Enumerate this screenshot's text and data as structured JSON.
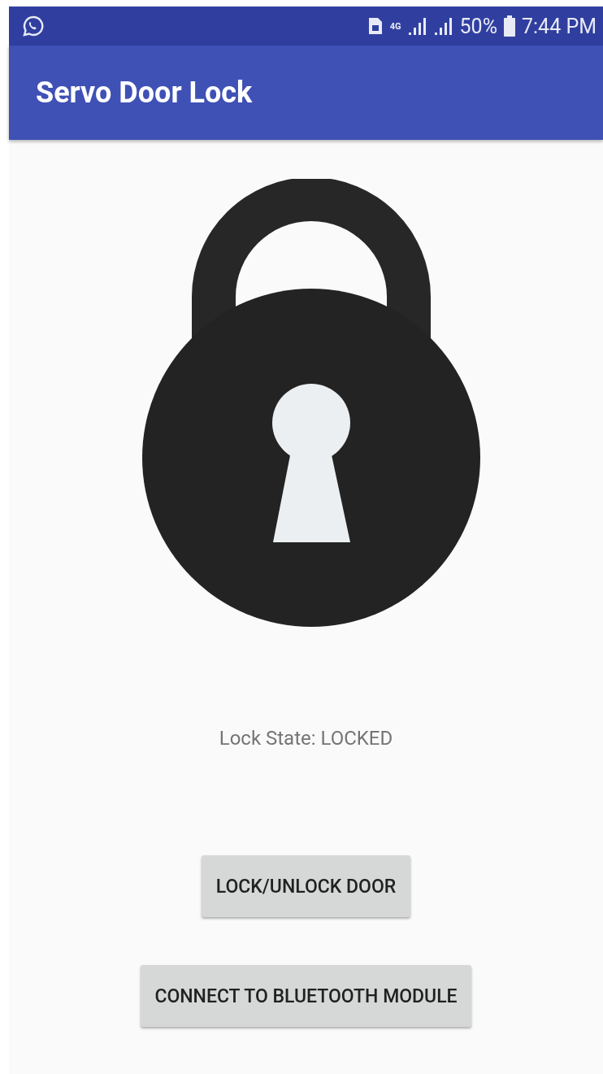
{
  "status_bar": {
    "network": "4G",
    "battery": "50%",
    "time": "7:44 PM"
  },
  "app_bar": {
    "title": "Servo Door Lock"
  },
  "lock_state": "Lock State: LOCKED",
  "buttons": [
    {
      "label": "LOCK/UNLOCK DOOR"
    },
    {
      "label": "CONNECT TO BLUETOOTH MODULE"
    }
  ]
}
